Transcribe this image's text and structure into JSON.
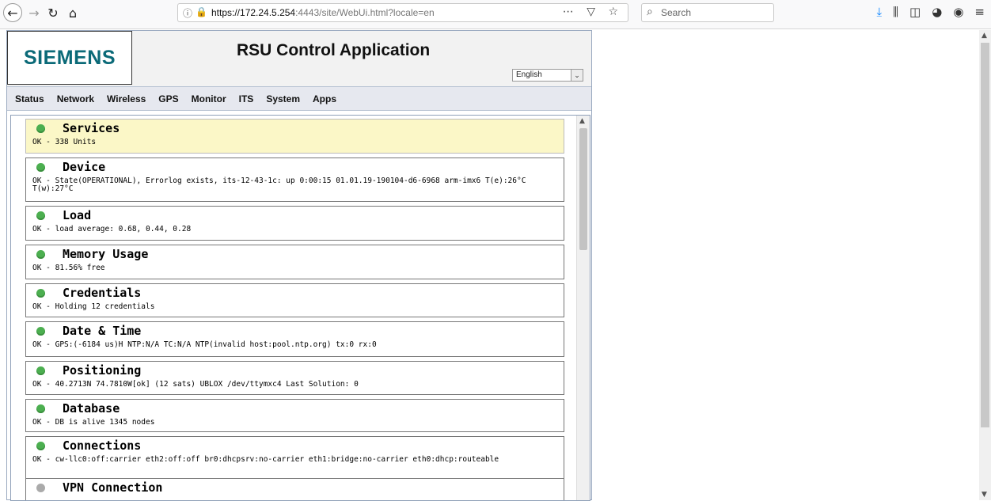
{
  "browser": {
    "url_host": "https://172.24.5.254",
    "url_rest": ":4443/site/WebUi.html?locale=en",
    "search_placeholder": "Search",
    "actions": "⋯ ▽ ☆"
  },
  "app": {
    "logo": "SIEMENS",
    "title": "RSU Control Application",
    "language": "English"
  },
  "menu": [
    "Status",
    "Network",
    "Wireless",
    "GPS",
    "Monitor",
    "ITS",
    "System",
    "Apps"
  ],
  "services": [
    {
      "title": "Services",
      "detail": "OK - 338 Units",
      "status": "ok",
      "highlight": true
    },
    {
      "title": "Device",
      "detail": "OK - State(OPERATIONAL), Errorlog exists, its-12-43-1c: up 0:00:15 01.01.19-190104-d6-6968 arm-imx6 T(e):26°C T(w):27°C",
      "status": "ok"
    },
    {
      "title": "Load",
      "detail": "OK - load average: 0.68, 0.44, 0.28",
      "status": "ok"
    },
    {
      "title": "Memory Usage",
      "detail": "OK - 81.56% free",
      "status": "ok"
    },
    {
      "title": "Credentials",
      "detail": "OK - Holding 12 credentials",
      "status": "ok"
    },
    {
      "title": "Date & Time",
      "detail": "OK - GPS:(-6184 us)H NTP:N/A TC:N/A NTP(invalid host:pool.ntp.org) tx:0 rx:0",
      "status": "ok"
    },
    {
      "title": "Positioning",
      "detail": "OK - 40.2713N 74.7810W[ok] (12 sats) UBLOX /dev/ttymxc4 Last Solution: 0",
      "status": "ok"
    },
    {
      "title": "Database",
      "detail": "OK - DB is alive 1345 nodes",
      "status": "ok"
    },
    {
      "title": "Connections",
      "detail": "OK - cw-llc0:off:carrier eth2:off:off br0:dhcpsrv:no-carrier eth1:bridge:no-carrier eth0:dhcp:routeable",
      "status": "ok"
    },
    {
      "title": "VPN Connection",
      "detail": "",
      "status": "unknown"
    }
  ],
  "colors": {
    "ok": "#4caf50",
    "unknown": "#aaaaaa",
    "highlight": "#fbf7c7"
  }
}
